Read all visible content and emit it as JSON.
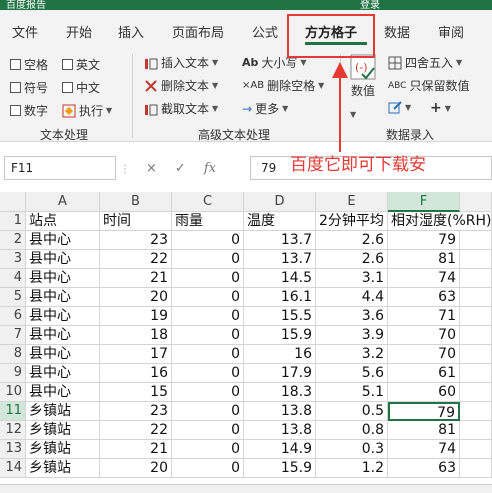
{
  "titlebar": {
    "left_text": "百度报告",
    "right_text": "登录"
  },
  "tabs": [
    {
      "label": "文件"
    },
    {
      "label": "开始"
    },
    {
      "label": "插入"
    },
    {
      "label": "页面布局"
    },
    {
      "label": "公式"
    },
    {
      "label": "方方格子"
    },
    {
      "label": "数据"
    },
    {
      "label": "审阅"
    }
  ],
  "active_tab": "方方格子",
  "ribbon": {
    "text_group": {
      "items": [
        "空格",
        "英文",
        "符号",
        "中文",
        "数字",
        "执行"
      ],
      "label": "文本处理"
    },
    "advanced_group": {
      "items": [
        "插入文本",
        "删除文本",
        "截取文本",
        "大小写",
        "删除空格",
        "更多"
      ],
      "label": "高级文本处理"
    },
    "numeric_group": {
      "value_label": "数值",
      "round_label": "四舍五入",
      "keep_label": "只保留数值",
      "label": "数据录入"
    }
  },
  "formula_bar": {
    "name_box": "F11",
    "cancel_icon": "×",
    "confirm_icon": "✓",
    "fx_label": "fx",
    "value": "79"
  },
  "annotation": "百度它即可下载安",
  "grid": {
    "columns": [
      "A",
      "B",
      "C",
      "D",
      "E",
      "F"
    ],
    "selected_column": "F",
    "header_row": [
      "站点",
      "时间",
      "雨量",
      "温度",
      "2分钟平均",
      "相对湿度(%RH)"
    ],
    "rows": [
      {
        "n": "2",
        "site": "县中心",
        "time": "23",
        "rain": "0",
        "temp": "13.7",
        "wind": "2.6",
        "hum": "79"
      },
      {
        "n": "3",
        "site": "县中心",
        "time": "22",
        "rain": "0",
        "temp": "13.7",
        "wind": "2.6",
        "hum": "81"
      },
      {
        "n": "4",
        "site": "县中心",
        "time": "21",
        "rain": "0",
        "temp": "14.5",
        "wind": "3.1",
        "hum": "74"
      },
      {
        "n": "5",
        "site": "县中心",
        "time": "20",
        "rain": "0",
        "temp": "16.1",
        "wind": "4.4",
        "hum": "63"
      },
      {
        "n": "6",
        "site": "县中心",
        "time": "19",
        "rain": "0",
        "temp": "15.5",
        "wind": "3.6",
        "hum": "71"
      },
      {
        "n": "7",
        "site": "县中心",
        "time": "18",
        "rain": "0",
        "temp": "15.9",
        "wind": "3.9",
        "hum": "70"
      },
      {
        "n": "8",
        "site": "县中心",
        "time": "17",
        "rain": "0",
        "temp": "16",
        "wind": "3.2",
        "hum": "70"
      },
      {
        "n": "9",
        "site": "县中心",
        "time": "16",
        "rain": "0",
        "temp": "17.9",
        "wind": "5.6",
        "hum": "61"
      },
      {
        "n": "10",
        "site": "县中心",
        "time": "15",
        "rain": "0",
        "temp": "18.3",
        "wind": "5.1",
        "hum": "60"
      },
      {
        "n": "11",
        "site": "乡镇站",
        "time": "23",
        "rain": "0",
        "temp": "13.8",
        "wind": "0.5",
        "hum": "79"
      },
      {
        "n": "12",
        "site": "乡镇站",
        "time": "22",
        "rain": "0",
        "temp": "13.8",
        "wind": "0.8",
        "hum": "81"
      },
      {
        "n": "13",
        "site": "乡镇站",
        "time": "21",
        "rain": "0",
        "temp": "14.9",
        "wind": "0.3",
        "hum": "74"
      },
      {
        "n": "14",
        "site": "乡镇站",
        "time": "20",
        "rain": "0",
        "temp": "15.9",
        "wind": "1.2",
        "hum": "63"
      }
    ],
    "header_row_number": "1",
    "selected_row": "11"
  },
  "colors": {
    "accent": "#217346",
    "annotation": "#e53935"
  }
}
